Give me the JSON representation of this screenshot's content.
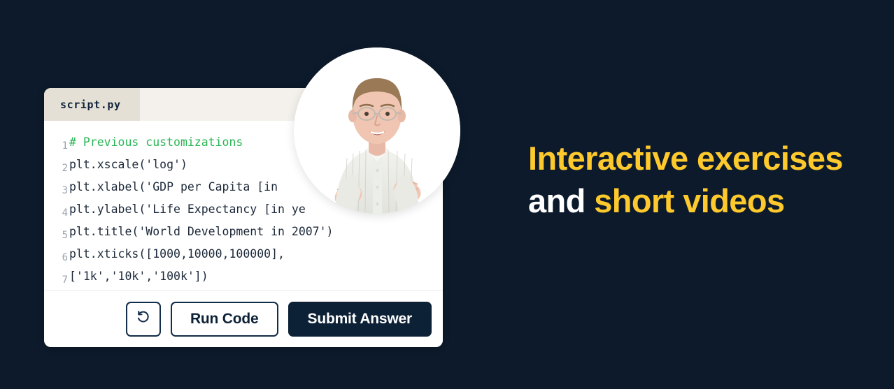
{
  "theme": {
    "background": "#0c1a2b",
    "accent_yellow": "#fdc92c",
    "card_background": "#ffffff",
    "tab_bar": "#f4f1ec",
    "tab_active": "#e4e0d6",
    "code_text": "#1d2a3a",
    "code_comment": "#2bb656",
    "code_string": "#8b5cf6",
    "button_dark": "#0d2136"
  },
  "editor": {
    "tab_label": "script.py",
    "lines": [
      {
        "number": "1",
        "text": "# Previous customizations",
        "kind": "comment"
      },
      {
        "number": "2",
        "text": "plt.xscale('log')",
        "kind": "code"
      },
      {
        "number": "3",
        "text": "plt.xlabel('GDP per Capita [in",
        "kind": "code"
      },
      {
        "number": "4",
        "text": "plt.ylabel('Life Expectancy [in ye",
        "kind": "code"
      },
      {
        "number": "5",
        "text": "plt.title('World Development in 2007')",
        "kind": "code"
      },
      {
        "number": "6",
        "text": "plt.xticks([1000,10000,100000],",
        "kind": "code"
      },
      {
        "number": "7",
        "text": "['1k','10k','100k'])",
        "kind": "code"
      }
    ]
  },
  "actions": {
    "reset_icon": "reset-arrow-icon",
    "run_code_label": "Run Code",
    "submit_answer_label": "Submit Answer"
  },
  "video": {
    "description": "instructor-video-bubble"
  },
  "headline": {
    "segment_1": "Interactive exercises",
    "segment_2": "and",
    "segment_3": "short videos"
  }
}
